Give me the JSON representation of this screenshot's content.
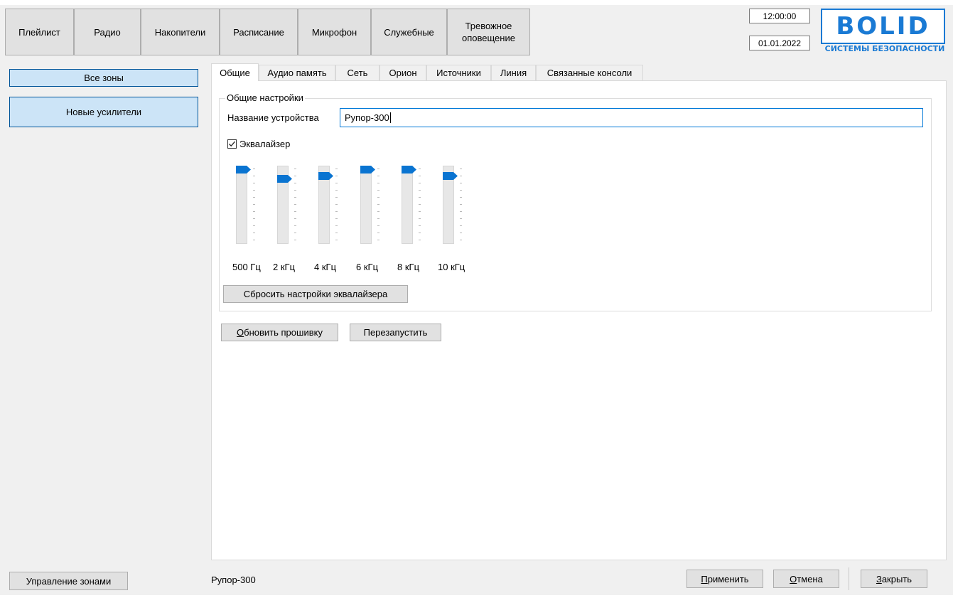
{
  "toolbar": {
    "buttons": [
      "Плейлист",
      "Радио",
      "Накопители",
      "Расписание",
      "Микрофон",
      "Служебные",
      "Тревожное\nоповещение"
    ]
  },
  "clock": {
    "time": "12:00:00",
    "date": "01.01.2022"
  },
  "logo": {
    "word": "BOLID",
    "subtitle": "СИСТЕМЫ БЕЗОПАСНОСТИ",
    "color": "#1a7ad4"
  },
  "sidebar": {
    "all_zones": "Все зоны",
    "new_amps": "Новые усилители",
    "manage_zones": "Управление зонами"
  },
  "tabs": [
    "Общие",
    "Аудио память",
    "Сеть",
    "Орион",
    "Источники",
    "Линия",
    "Связанные консоли"
  ],
  "active_tab": "Общие",
  "general": {
    "group_title": "Общие настройки",
    "name_label": "Название устройства",
    "name_value": "Рупор-300",
    "eq_label": "Эквалайзер",
    "eq_checked": true,
    "eq_bands": [
      {
        "label": "500 Гц",
        "level": 1.0
      },
      {
        "label": "2 кГц",
        "level": 0.72
      },
      {
        "label": "4 кГц",
        "level": 0.81
      },
      {
        "label": "6 кГц",
        "level": 1.0
      },
      {
        "label": "8 кГц",
        "level": 1.0
      },
      {
        "label": "10 кГц",
        "level": 0.81
      }
    ],
    "reset_eq": "Сбросить настройки эквалайзера"
  },
  "actions": {
    "update_fw": "Обновить прошивку",
    "update_fw_accel": "О",
    "update_fw_rest": "бновить прошивку",
    "restart": "Перезапустить"
  },
  "footer": {
    "status": "Рупор-300",
    "apply_accel": "П",
    "apply_rest": "рименить",
    "cancel_accel": "О",
    "cancel_rest": "тмена",
    "close_accel": "З",
    "close_rest": "акрыть"
  },
  "colors": {
    "accent": "#0078d7",
    "selected_bg": "#cce4f7",
    "thumb": "#0a74d1"
  }
}
